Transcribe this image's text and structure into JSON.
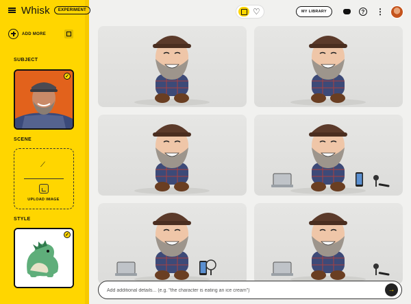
{
  "app": {
    "title": "Whisk",
    "badge": "EXPERIMENT"
  },
  "sidebar": {
    "add_more_label": "ADD MORE",
    "subject": {
      "label": "SUBJECT",
      "selected": true
    },
    "scene": {
      "label": "SCENE",
      "upload_label": "UPLOAD IMAGE"
    },
    "style": {
      "label": "STYLE",
      "selected": true
    }
  },
  "header": {
    "my_library_label": "MY LIBRARY",
    "help_glyph": "?",
    "more_glyph": "⋮",
    "heart_glyph": "♡"
  },
  "prompt": {
    "placeholder": "Add additional details... (e.g. \"the character is eating an ice cream\")",
    "send_glyph": "→"
  },
  "icons": {
    "menu": "hamburger-icon",
    "add": "plus-circle-icon",
    "collapse": "panel-collapse-icon",
    "wand": "magic-wand-icon",
    "upload": "image-upload-icon",
    "grid_view": "grid-view-icon",
    "favorites": "heart-icon",
    "discord": "discord-icon",
    "help": "help-icon",
    "more": "more-vert-icon",
    "send": "arrow-right-icon",
    "check": "check-icon"
  },
  "colors": {
    "accent": "#ffd600",
    "background": "#f1f1ef",
    "dark": "#111111"
  },
  "results": [
    {
      "id": "result-1",
      "props": []
    },
    {
      "id": "result-2",
      "props": []
    },
    {
      "id": "result-3",
      "props": []
    },
    {
      "id": "result-4",
      "props": [
        "laptop",
        "phone",
        "microphone"
      ]
    },
    {
      "id": "result-5",
      "props": [
        "laptop",
        "phone",
        "fan"
      ]
    },
    {
      "id": "result-6",
      "props": [
        "laptop",
        "microphone"
      ]
    }
  ]
}
